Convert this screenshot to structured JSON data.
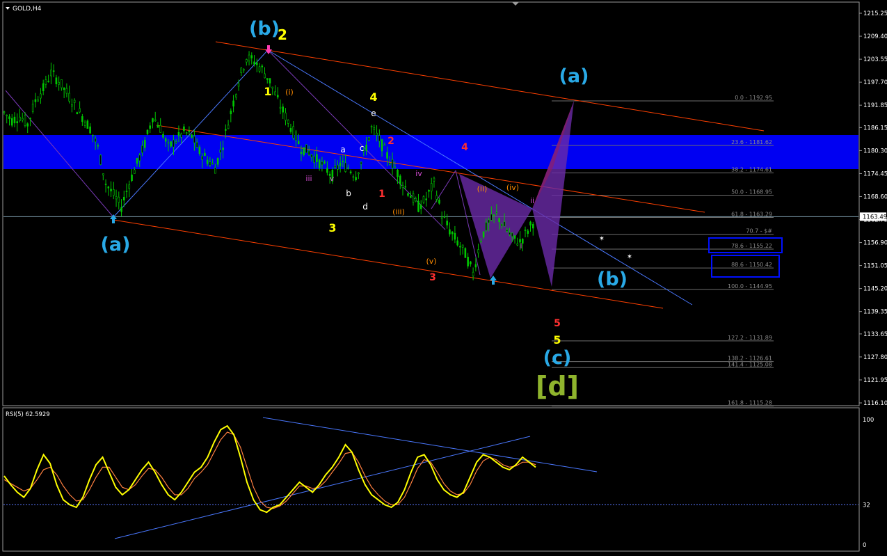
{
  "window": {
    "title": "GOLD,H4"
  },
  "colors": {
    "bg": "#000000",
    "candle": "#00c800",
    "fib": "#6e6e6e",
    "channel": "#ff4000",
    "trend": "#4a78ff",
    "band": "#0000ff",
    "purple": "#6a2aa8",
    "rsi": "#ffff00",
    "rsi_ma": "#ff8040"
  },
  "chart_data": [
    {
      "type": "candlestick",
      "title": "GOLD,H4",
      "symbol": "GOLD",
      "timeframe": "H4",
      "current_price": "1163.49",
      "y_ticks": [
        "1215.25",
        "1209.40",
        "1203.55",
        "1197.70",
        "1191.85",
        "1186.15",
        "1180.30",
        "1174.45",
        "1168.60",
        "1162.75",
        "1156.90",
        "1151.05",
        "1145.20",
        "1139.35",
        "1133.65",
        "1127.80",
        "1121.95",
        "1116.10"
      ],
      "fib_levels": [
        {
          "label": "0.0 - 1192.95",
          "price": 1192.95
        },
        {
          "label": "23.6 - 1181.62",
          "price": 1181.62
        },
        {
          "label": "38.2 - 1174.61",
          "price": 1174.61
        },
        {
          "label": "50.0 - 1168.95",
          "price": 1168.95
        },
        {
          "label": "61.8 - 1163.29",
          "price": 1163.29
        },
        {
          "label": "70.7 - $#",
          "price": 1159.0
        },
        {
          "label": "78.6 - 1155.22",
          "price": 1155.22
        },
        {
          "label": "88.6 - 1150.42",
          "price": 1150.42
        },
        {
          "label": "100.0 - 1144.95",
          "price": 1144.95
        },
        {
          "label": "127.2 - 1131.89",
          "price": 1131.89
        },
        {
          "label": "138.2 - 1126.61",
          "price": 1126.61
        },
        {
          "label": "141.4 - 1125.08",
          "price": 1125.08
        },
        {
          "label": "161.8 - 1115.28",
          "price": 1115.28
        }
      ],
      "approx_path": [
        1190,
        1188,
        1189,
        1187,
        1193,
        1196,
        1200,
        1198,
        1195,
        1192,
        1189,
        1186,
        1181,
        1172,
        1169,
        1166,
        1172,
        1177,
        1182,
        1189,
        1186,
        1181,
        1183,
        1185,
        1184,
        1180,
        1178,
        1176,
        1182,
        1190,
        1198,
        1204,
        1203,
        1201,
        1198,
        1193,
        1189,
        1185,
        1181,
        1180,
        1178,
        1176,
        1174,
        1177,
        1176,
        1174,
        1179,
        1186,
        1183,
        1179,
        1176,
        1172,
        1169,
        1166,
        1168,
        1172,
        1164,
        1160,
        1157,
        1154,
        1149,
        1158,
        1162,
        1164,
        1161,
        1158,
        1157,
        1160,
        1163
      ]
    },
    {
      "type": "line",
      "title": "RSI(5) 62.5929",
      "y_ticks": [
        "100",
        "32",
        "0"
      ],
      "level": 32,
      "series": [
        {
          "name": "RSI(5)",
          "values": [
            55,
            48,
            42,
            38,
            45,
            60,
            72,
            65,
            48,
            36,
            32,
            30,
            38,
            52,
            64,
            70,
            58,
            46,
            40,
            44,
            52,
            60,
            66,
            58,
            48,
            40,
            36,
            42,
            50,
            58,
            62,
            70,
            82,
            92,
            95,
            88,
            70,
            50,
            36,
            28,
            26,
            30,
            32,
            38,
            44,
            50,
            46,
            42,
            48,
            56,
            62,
            70,
            80,
            74,
            60,
            48,
            40,
            36,
            32,
            30,
            34,
            44,
            58,
            70,
            72,
            64,
            52,
            44,
            40,
            38,
            42,
            54,
            66,
            72,
            70,
            66,
            62,
            60,
            64,
            70,
            66,
            62
          ]
        },
        {
          "name": "MA",
          "values": [
            52,
            49,
            46,
            43,
            45,
            52,
            60,
            62,
            56,
            47,
            40,
            35,
            36,
            44,
            54,
            62,
            62,
            54,
            46,
            44,
            48,
            55,
            61,
            60,
            54,
            46,
            40,
            40,
            45,
            53,
            58,
            64,
            74,
            84,
            90,
            88,
            78,
            62,
            46,
            35,
            30,
            29,
            31,
            35,
            41,
            47,
            47,
            45,
            46,
            51,
            58,
            65,
            73,
            74,
            66,
            55,
            46,
            40,
            35,
            32,
            32,
            38,
            49,
            61,
            68,
            66,
            58,
            49,
            43,
            40,
            41,
            48,
            59,
            67,
            70,
            68,
            64,
            62,
            63,
            66,
            66,
            64
          ]
        }
      ]
    }
  ],
  "wave_labels": [
    {
      "text": "(a)",
      "color": "#29a9e6",
      "size": 27
    },
    {
      "text": "(b)",
      "color": "#29a9e6",
      "size": 27
    },
    {
      "text": "2",
      "color": "#ffff00",
      "size": 20
    },
    {
      "text": "(a)",
      "color": "#29a9e6",
      "size": 27
    },
    {
      "text": "(b)",
      "color": "#29a9e6",
      "size": 27
    },
    {
      "text": "(c)",
      "color": "#29a9e6",
      "size": 27
    },
    {
      "text": "[d]",
      "color": "#8fb42d",
      "size": 38
    },
    {
      "text": "4",
      "color": "#ffff00",
      "size": 16
    },
    {
      "text": "3",
      "color": "#ffff00",
      "size": 16
    },
    {
      "text": "5",
      "color": "#ffff00",
      "size": 16
    },
    {
      "text": "1",
      "color": "#ffff00",
      "size": 16
    },
    {
      "text": "4",
      "color": "#ff3030",
      "size": 14
    },
    {
      "text": "2",
      "color": "#ff3030",
      "size": 14
    },
    {
      "text": "1",
      "color": "#ff3030",
      "size": 14
    },
    {
      "text": "3",
      "color": "#ff3030",
      "size": 14
    },
    {
      "text": "5",
      "color": "#ff3030",
      "size": 14
    },
    {
      "text": "a",
      "color": "#ffffff",
      "size": 12
    },
    {
      "text": "b",
      "color": "#ffffff",
      "size": 12
    },
    {
      "text": "c",
      "color": "#ffffff",
      "size": 12
    },
    {
      "text": "d",
      "color": "#ffffff",
      "size": 12
    },
    {
      "text": "e",
      "color": "#ffffff",
      "size": 12
    },
    {
      "text": "(i)",
      "color": "#ff8c00",
      "size": 11
    },
    {
      "text": "(ii)",
      "color": "#ff8c00",
      "size": 11
    },
    {
      "text": "(iii)",
      "color": "#ff8c00",
      "size": 11
    },
    {
      "text": "(iv)",
      "color": "#ff8c00",
      "size": 11
    },
    {
      "text": "(v)",
      "color": "#ff8c00",
      "size": 11
    },
    {
      "text": "i",
      "color": "#d24bd2",
      "size": 11
    },
    {
      "text": "ii",
      "color": "#d24bd2",
      "size": 11
    },
    {
      "text": "iii",
      "color": "#d24bd2",
      "size": 11
    },
    {
      "text": "iv",
      "color": "#d24bd2",
      "size": 11
    },
    {
      "text": "v",
      "color": "#d24bd2",
      "size": 11
    }
  ]
}
